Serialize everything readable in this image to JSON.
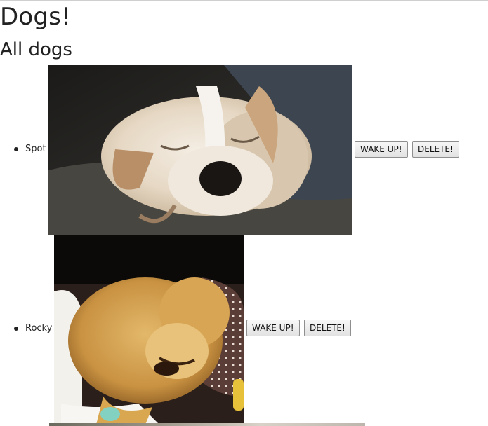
{
  "page": {
    "title": "Dogs!",
    "subtitle": "All dogs"
  },
  "dogs": [
    {
      "name": "Spot",
      "wake_label": "WAKE UP!",
      "delete_label": "DELETE!"
    },
    {
      "name": "Rocky",
      "wake_label": "WAKE UP!",
      "delete_label": "DELETE!"
    }
  ]
}
